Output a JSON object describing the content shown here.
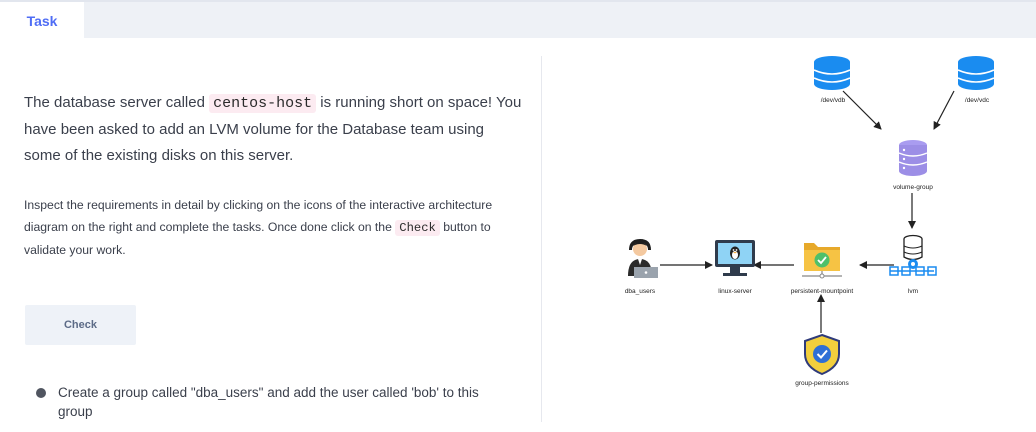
{
  "tabs": {
    "task_label": "Task"
  },
  "intro": {
    "part1": "The database server called ",
    "server_code": "centos-host",
    "part2": " is running short on space! You have been asked to add an LVM volume for the Database team using some of the existing disks on this server."
  },
  "instructions": {
    "part1": "Inspect the requirements in detail by clicking on the icons of the interactive architecture diagram on the right and complete the tasks. Once done click on the ",
    "check_code": "Check",
    "part2": " button to validate your work."
  },
  "check_button": {
    "label": "Check"
  },
  "tasks": [
    {
      "text": "Create a group called \"dba_users\" and add the user called 'bob' to this group"
    }
  ],
  "diagram": {
    "nodes": {
      "dev_vdb": {
        "label": "/dev/vdb",
        "icon": "database-icon"
      },
      "dev_vdc": {
        "label": "/dev/vdc",
        "icon": "database-icon"
      },
      "volume_group": {
        "label": "volume-group",
        "icon": "volume-group-icon"
      },
      "lvm": {
        "label": "lvm",
        "icon": "lvm-icon"
      },
      "persistent_mountpoint": {
        "label": "persistent-mountpoint",
        "icon": "folder-check-icon"
      },
      "linux_server": {
        "label": "linux-server",
        "icon": "linux-monitor-icon"
      },
      "dba_users": {
        "label": "dba_users",
        "icon": "user-icon"
      },
      "group_permissions": {
        "label": "group-permissions",
        "icon": "shield-check-icon"
      }
    }
  },
  "colors": {
    "accent": "#4f6df5",
    "db_blue": "#1a8cf0",
    "vg_purple": "#9c8ee6",
    "folder_yellow": "#f6c344",
    "check_green": "#4fc06a",
    "shield_yellow": "#f2cf3d"
  }
}
